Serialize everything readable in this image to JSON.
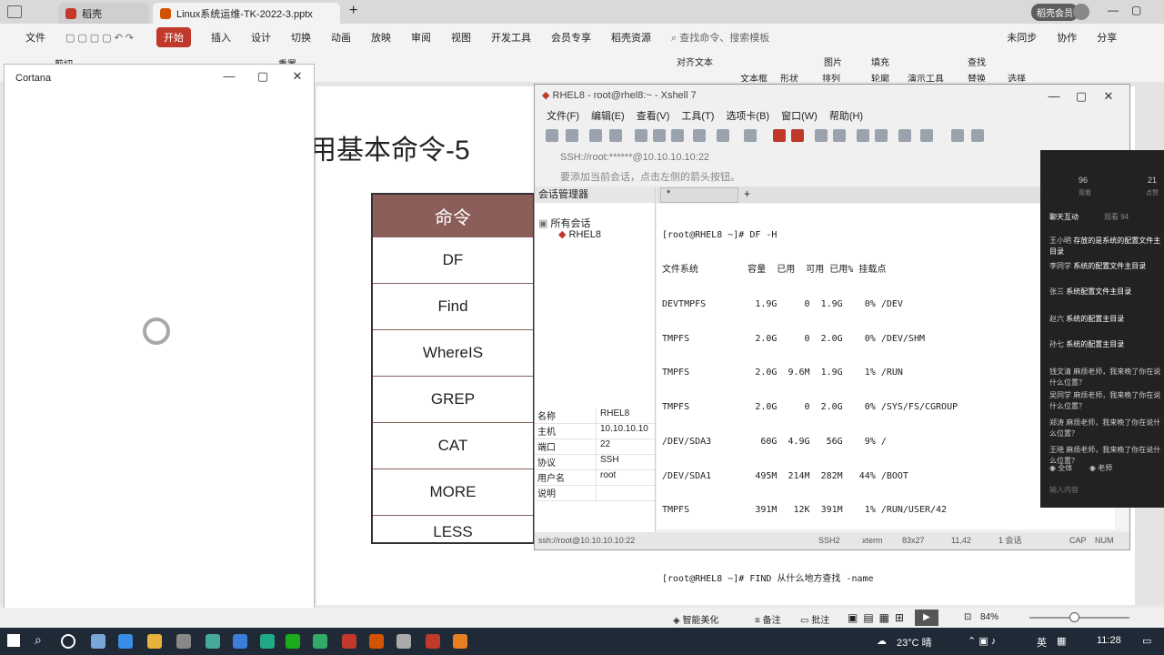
{
  "wps": {
    "tabs": [
      {
        "label": "稻壳"
      },
      {
        "label": "Linux系统运维-TK-2022-3.pptx"
      }
    ],
    "user_button": "稻壳会员",
    "menu": [
      "文件",
      "开始",
      "插入",
      "设计",
      "切换",
      "动画",
      "放映",
      "审阅",
      "视图",
      "开发工具",
      "会员专享",
      "稻壳资源"
    ],
    "search_placeholder": "查找命令、搜索模板",
    "sync": "未同步",
    "collab": "协作",
    "share": "分享",
    "ribbon": {
      "cut": "剪切",
      "reset": "重置",
      "align_text": "对齐文本",
      "textbox": "文本框",
      "shape": "形状",
      "arrange": "排列",
      "image": "图片",
      "fill": "填充",
      "find": "查找",
      "replace": "替换",
      "select": "选择",
      "outline": "轮廓",
      "present": "演示工具"
    }
  },
  "slide": {
    "title": "用基本命令-5",
    "table_header": "命令",
    "commands": [
      "DF",
      "Find",
      "WhereIS",
      "GREP",
      "CAT",
      "MORE",
      "LESS"
    ]
  },
  "cortana": {
    "title": "Cortana"
  },
  "xshell": {
    "title": "RHEL8 - root@rhel8:~ - Xshell 7",
    "menu": [
      "文件(F)",
      "编辑(E)",
      "查看(V)",
      "工具(T)",
      "选项卡(B)",
      "窗口(W)",
      "帮助(H)"
    ],
    "address": "SSH://root:******@10.10.10.10:22",
    "hint": "要添加当前会话，点击左侧的箭头按钮。",
    "session_manager": "会话管理器",
    "tree_all": "所有会话",
    "tree_item": "RHEL8",
    "tab_label": "*",
    "properties": [
      {
        "k": "名称",
        "v": "RHEL8"
      },
      {
        "k": "主机",
        "v": "10.10.10.10"
      },
      {
        "k": "端口",
        "v": "22"
      },
      {
        "k": "协议",
        "v": "SSH"
      },
      {
        "k": "用户名",
        "v": "root"
      },
      {
        "k": "说明",
        "v": ""
      }
    ],
    "terminal_lines": [
      "[root@RHEL8 ~]# DF -H",
      "文件系统         容量  已用  可用 已用% 挂载点",
      "DEVTMPFS         1.9G     0  1.9G    0% /DEV",
      "TMPFS            2.0G     0  2.0G    0% /DEV/SHM",
      "TMPFS            2.0G  9.6M  1.9G    1% /RUN",
      "TMPFS            2.0G     0  2.0G    0% /SYS/FS/CGROUP",
      "/DEV/SDA3         60G  4.9G   56G    9% /",
      "/DEV/SDA1        495M  214M  282M   44% /BOOT",
      "TMPFS            391M   12K  391M    1% /RUN/USER/42",
      "TMPFS            391M     0  391M    0% /RUN/USER/0",
      "[root@RHEL8 ~]# FIND 从什么地方查找 -name"
    ],
    "status": {
      "left": "ssh://root@10.10.10.10:22",
      "proto": "SSH2",
      "term": "xterm",
      "size": "83x27",
      "pos": "11,42",
      "sessions": "1 会话",
      "cap": "CAP",
      "num": "NUM"
    }
  },
  "chat": {
    "stats": [
      "96",
      "21"
    ],
    "stat_labels": [
      "观看",
      "点赞"
    ],
    "tabs": [
      "聊天互动",
      "观看 94"
    ],
    "messages": [
      {
        "who": "王小明",
        "text": "存放的是系统的配置文件主目录"
      },
      {
        "who": "李同学",
        "text": "系统的配置文件主目录"
      },
      {
        "who": "张三",
        "text": "系统配置文件主目录"
      },
      {
        "who": "赵六",
        "text": "系统的配置主目录"
      },
      {
        "who": "孙七",
        "text": "系统的配置主目录"
      },
      {
        "who": "钱文清",
        "text": "麻烦老师，我来晚了你在说什么位置？"
      },
      {
        "who": "吴同学",
        "text": "麻烦老师，我来晚了你在说什么位置？"
      },
      {
        "who": "郑涛",
        "text": "麻烦老师，我来晚了你在说什么位置？"
      },
      {
        "who": "王晓",
        "text": "麻烦老师，我来晚了你在说什么位置？"
      }
    ],
    "options": [
      "全体",
      "老师"
    ],
    "input_placeholder": "输入内容"
  },
  "status_bar": {
    "beautify": "智能美化",
    "notes": "备注",
    "comment": "批注",
    "zoom": "84%"
  },
  "taskbar": {
    "weather": "23°C 晴",
    "ime": "英",
    "time": "11:28"
  }
}
